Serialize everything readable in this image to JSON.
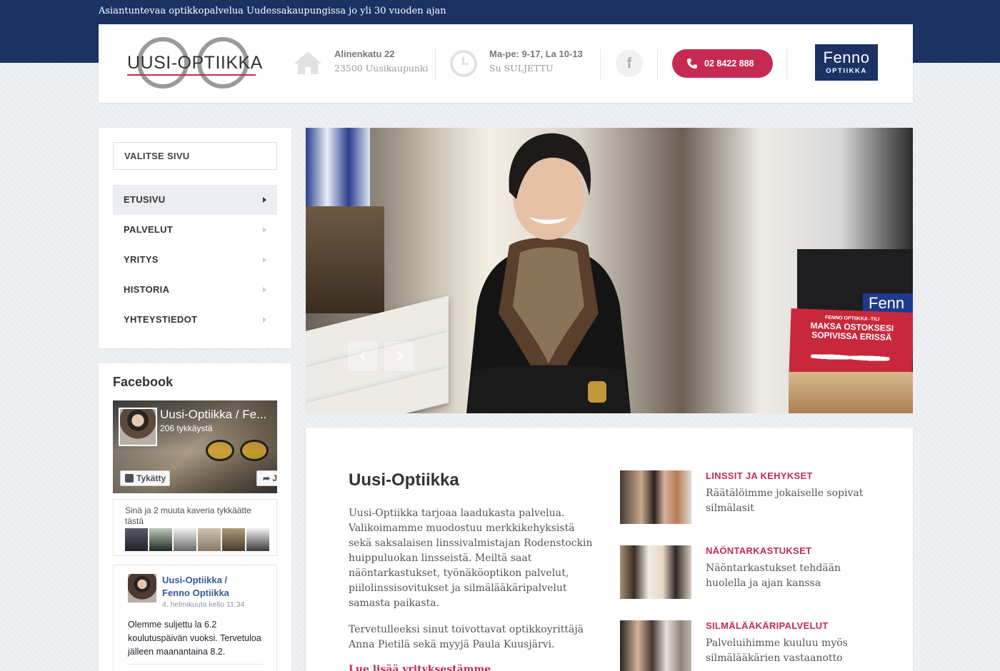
{
  "tagline": "Asiantuntevaa optikkopalvelua Uudessakaupungissa jo yli 30 vuoden ajan",
  "header": {
    "logo_text": "UUSI-OPTIIKKA",
    "address_line1": "Alinenkatu 22",
    "address_line2": "23500 Uusikaupunki",
    "hours_line1": "Ma-pe: 9-17, La 10-13",
    "hours_line2": "Su SULJETTU",
    "facebook_glyph": "f",
    "phone": "02 8422 888",
    "partner_name": "Fenno",
    "partner_sub": "OPTIIKKA",
    "accent_color": "#c62a52",
    "brand_color": "#1b3263"
  },
  "sidebar": {
    "select_label": "VALITSE SIVU",
    "nav": [
      {
        "label": "ETUSIVU",
        "active": true
      },
      {
        "label": "PALVELUT",
        "active": false
      },
      {
        "label": "YRITYS",
        "active": false
      },
      {
        "label": "HISTORIA",
        "active": false
      },
      {
        "label": "YHTEYSTIEDOT",
        "active": false
      }
    ]
  },
  "facebook": {
    "title": "Facebook",
    "page_name": "Uusi-Optiikka / Fe...",
    "likes": "206 tykkäystä",
    "like_button": "Tykätty",
    "share_button": "J",
    "friends_text": "Sinä ja 2 muuta kaveria tykkäätte tästä",
    "post_author": "Uusi-Optiikka / Fenno Optiikka",
    "post_date": "4. helmikuuta kello 11:34",
    "post_text": "Olemme suljettu la 6.2 koulutuspäivän vuoksi. Tervetuloa jälleen maanantaina 8.2."
  },
  "slider": {
    "ad_small": "FENNO OPTIIKKA -TILI",
    "ad_big": "MAKSA OSTOKSESI SOPIVISSA ERISSÄ",
    "sign_text": "Fenn",
    "icons": [
      "chevron-left-icon",
      "chevron-right-icon"
    ]
  },
  "content": {
    "title": "Uusi-Optiikka",
    "p1": "Uusi-Optiikka tarjoaa laadukasta palvelua. Valikoimamme muodostuu merkkikehyksistä sekä saksalaisen linssivalmistajan Rodenstockin huippuluokan linsseistä. Meiltä saat näöntarkastukset, työnäköoptikon palvelut, piilolinssisovitukset ja silmälääkäripalvelut samasta paikasta.",
    "p2": "Tervetulleeksi sinut toivottavat optikkoyrittäjä Anna Pietilä sekä myyjä Paula Kuusjärvi.",
    "more_link": "Lue lisää yrityksestämme",
    "services": [
      {
        "title": "LINSSIT JA KEHYKSET",
        "desc": "Räätälöimme jokaiselle sopivat silmälasit"
      },
      {
        "title": "NÄÖNTARKASTUKSET",
        "desc": "Näöntarkastukset tehdään huolella ja ajan kanssa"
      },
      {
        "title": "SILMÄLÄÄKÄRIPALVELUT",
        "desc": "Palveluihimme kuuluu myös silmälääkärien vastaanotto"
      }
    ]
  }
}
